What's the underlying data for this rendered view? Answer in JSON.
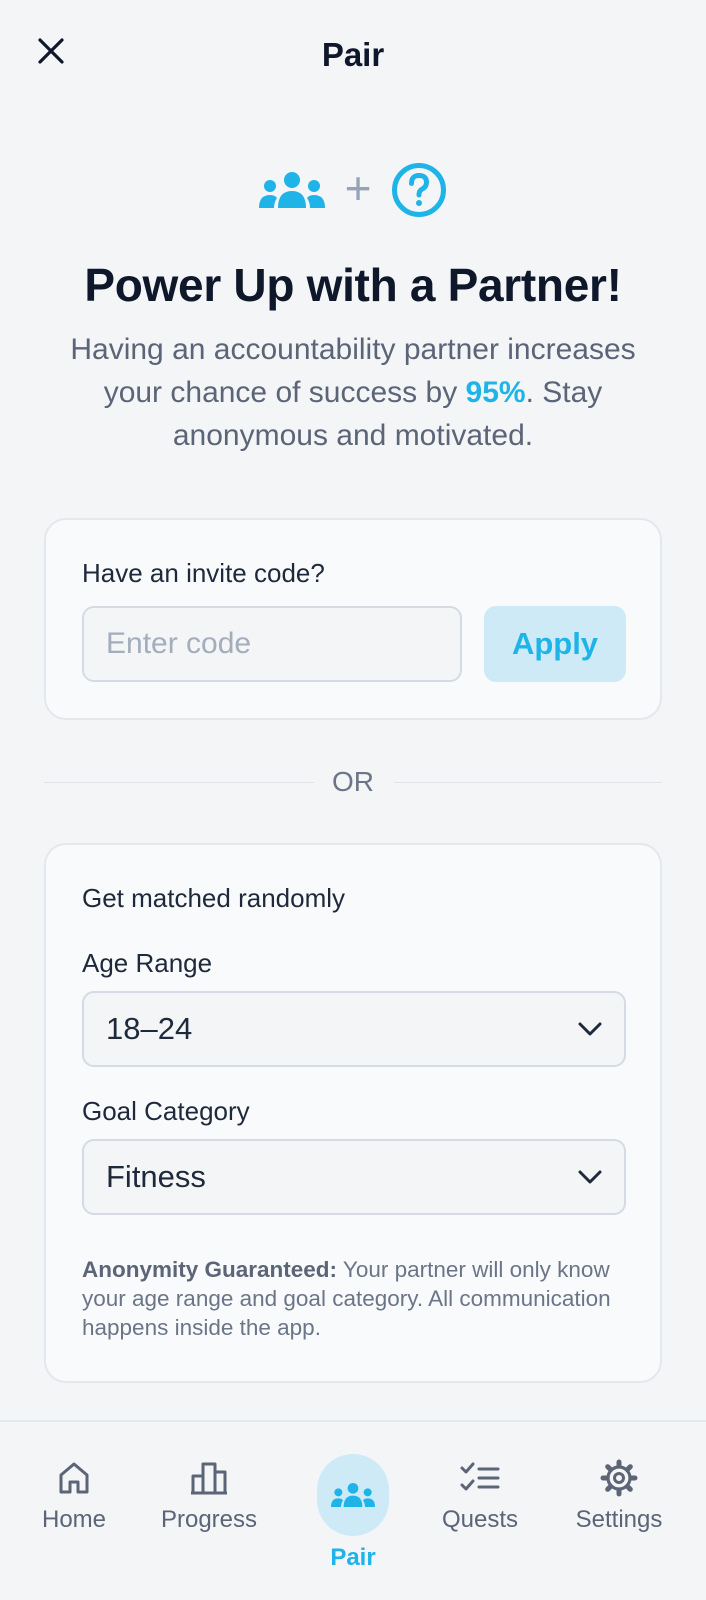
{
  "header": {
    "title": "Pair",
    "close_icon": "close-icon"
  },
  "hero": {
    "icons": [
      "users-icon",
      "question-circle-icon"
    ],
    "plus": "+",
    "headline": "Power Up with a Partner!",
    "description_before": "Having an accountability partner increases your chance of success by ",
    "description_highlight": "95%",
    "description_after": ". Stay anonymous and motivated."
  },
  "invite": {
    "label": "Have an invite code?",
    "placeholder": "Enter code",
    "value": "",
    "apply_label": "Apply"
  },
  "divider": {
    "text": "OR"
  },
  "match": {
    "title": "Get matched randomly",
    "age_label": "Age Range",
    "age_value": "18–24",
    "goal_label": "Goal Category",
    "goal_value": "Fitness",
    "note_bold": "Anonymity Guaranteed:",
    "note_text": " Your partner will only know your age range and goal category. All communication happens inside the app."
  },
  "nav": {
    "items": [
      {
        "label": "Home",
        "icon": "home-icon"
      },
      {
        "label": "Progress",
        "icon": "bar-chart-icon"
      },
      {
        "label": "Pair",
        "icon": "users-icon",
        "active": true
      },
      {
        "label": "Quests",
        "icon": "checklist-icon"
      },
      {
        "label": "Settings",
        "icon": "gear-icon"
      }
    ]
  },
  "colors": {
    "accent": "#1fb4e8",
    "accent_soft": "#cdeaf6",
    "background": "#f3f5f7",
    "text_primary": "#0f172a",
    "text_secondary": "#5b6577"
  }
}
